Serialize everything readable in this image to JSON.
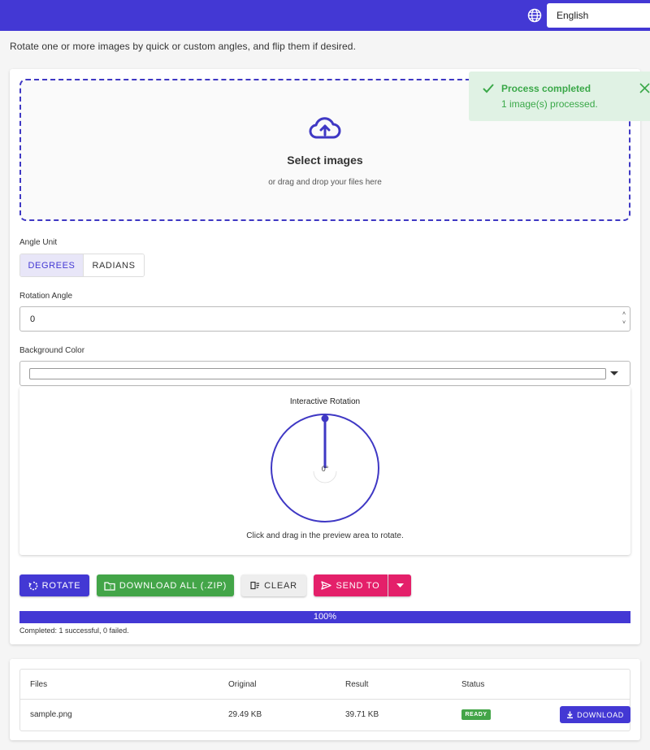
{
  "header": {
    "language": "English",
    "globe_icon": "globe-icon"
  },
  "page": {
    "subtitle": "Rotate one or more images by quick or custom angles, and flip them if desired."
  },
  "dropzone": {
    "title": "Select images",
    "subtitle": "or drag and drop your files here",
    "icon": "cloud-upload-icon"
  },
  "toast": {
    "title": "Process completed",
    "message": "1 image(s) processed.",
    "color": "#3aa848"
  },
  "form": {
    "angle_unit_label": "Angle Unit",
    "unit_degrees": "DEGREES",
    "unit_radians": "RADIANS",
    "selected_unit": "DEGREES",
    "rotation_angle_label": "Rotation Angle",
    "rotation_angle_value": "0",
    "background_color_label": "Background Color",
    "background_color_value": "#ffffff"
  },
  "rotation": {
    "title": "Interactive Rotation",
    "center_label": "0°",
    "hint": "Click and drag in the preview area to rotate."
  },
  "actions": {
    "rotate": "ROTATE",
    "download_all": "DOWNLOAD ALL (.ZIP)",
    "clear": "CLEAR",
    "send_to": "SEND TO"
  },
  "progress": {
    "value": 100,
    "text": "100%",
    "status": "Completed: 1 successful, 0 failed."
  },
  "table": {
    "headers": [
      "Files",
      "Original",
      "Result",
      "Status"
    ],
    "rows": [
      {
        "file": "sample.png",
        "original": "29.49 KB",
        "result": "39.71 KB",
        "status": "READY",
        "action": "DOWNLOAD"
      }
    ]
  },
  "colors": {
    "primary": "#4338d4",
    "success": "#43a548",
    "accent": "#e4206a"
  }
}
